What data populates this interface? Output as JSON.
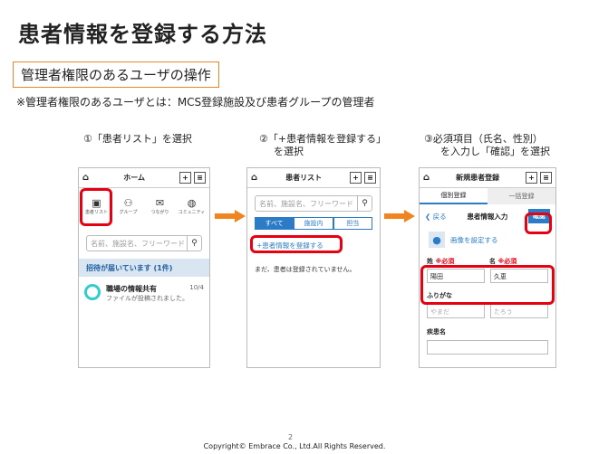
{
  "title": "患者情報を登録する方法",
  "subtitle": "管理者権限のあるユーザの操作",
  "note": "※管理者権限のあるユーザとは：MCS登録施設及び患者グループの管理者",
  "steps": {
    "s1": "①「患者リスト」を選択",
    "s2a": "②「+患者情報を登録する」",
    "s2b": "を選択",
    "s3a": "③必須項目（氏名、性別）",
    "s3b": "を入力し「確認」を選択"
  },
  "phone1": {
    "header": "ホーム",
    "icons": [
      "患者リスト",
      "グループ",
      "つながり",
      "コミュニティ"
    ],
    "search_placeholder": "名前、施設名、フリーワード",
    "invite_bar": "招待が届いています (1件)",
    "item_title": "職場の情報共有",
    "item_date": "10/4",
    "item_sub": "ファイルが投稿されました。"
  },
  "phone2": {
    "header": "患者リスト",
    "search_placeholder": "名前、施設名、フリーワード",
    "tabs": [
      "すべて",
      "施設内",
      "担当"
    ],
    "register_link": "+患者情報を登録する",
    "empty_msg": "まだ、患者は登録されていません。"
  },
  "phone3": {
    "header": "新規患者登録",
    "tab_individual": "個別登録",
    "tab_bulk": "一括登録",
    "back": "戻る",
    "subheader": "患者情報入力",
    "confirm": "確認",
    "image_label": "画像を設定する",
    "last_label": "姓",
    "first_label": "名",
    "required": "※必須",
    "last_value": "陽田",
    "first_value": "久恵",
    "kana_label": "ふりがな",
    "kana_last_ph": "やまだ",
    "kana_first_ph": "たろう",
    "disease_label": "疾患名"
  },
  "page_number": "2",
  "footer": "Copyright© Embrace Co., Ltd.All Rights Reserved."
}
